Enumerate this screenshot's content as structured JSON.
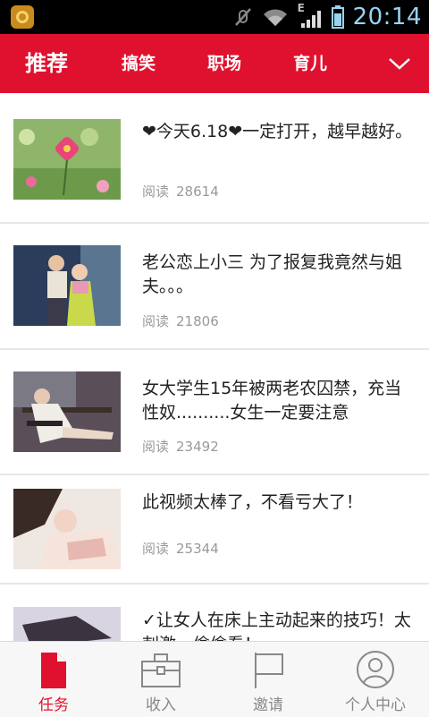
{
  "status_bar": {
    "time": "20:14",
    "network_type": "E",
    "icons": [
      "app-notification-icon",
      "mute-icon",
      "wifi-icon",
      "signal-icon",
      "battery-icon"
    ],
    "time_color": "#9ad3f2"
  },
  "tabs": {
    "items": [
      {
        "label": "推荐",
        "active": true
      },
      {
        "label": "搞笑",
        "active": false
      },
      {
        "label": "职场",
        "active": false
      },
      {
        "label": "育儿",
        "active": false
      }
    ],
    "expand_icon": "chevron-down-icon",
    "background": "#e0112f"
  },
  "feed": {
    "read_label": "阅读",
    "items": [
      {
        "title": "❤今天6.18❤一定打开，越早越好。",
        "reads": "28614",
        "thumb": "pink-flower-photo"
      },
      {
        "title": "老公恋上小三 为了报复我竟然与姐夫。。。",
        "reads": "21806",
        "thumb": "couple-photo"
      },
      {
        "title": "女大学生15年被两老农囚禁，充当性奴..........女生一定要注意",
        "reads": "23492",
        "thumb": "woman-on-bench-photo"
      },
      {
        "title": "此视频太棒了，不看亏大了！",
        "reads": "25344",
        "thumb": "woman-lying-photo"
      },
      {
        "title": "✓让女人在床上主动起来的技巧！太刺激，偷偷看！",
        "reads": "",
        "thumb": "partial-photo"
      }
    ]
  },
  "bottom_nav": {
    "items": [
      {
        "label": "任务",
        "icon": "document-icon",
        "active": true
      },
      {
        "label": "收入",
        "icon": "briefcase-icon",
        "active": false
      },
      {
        "label": "邀请",
        "icon": "flag-icon",
        "active": false
      },
      {
        "label": "个人中心",
        "icon": "person-icon",
        "active": false
      }
    ],
    "active_color": "#e0112f"
  }
}
